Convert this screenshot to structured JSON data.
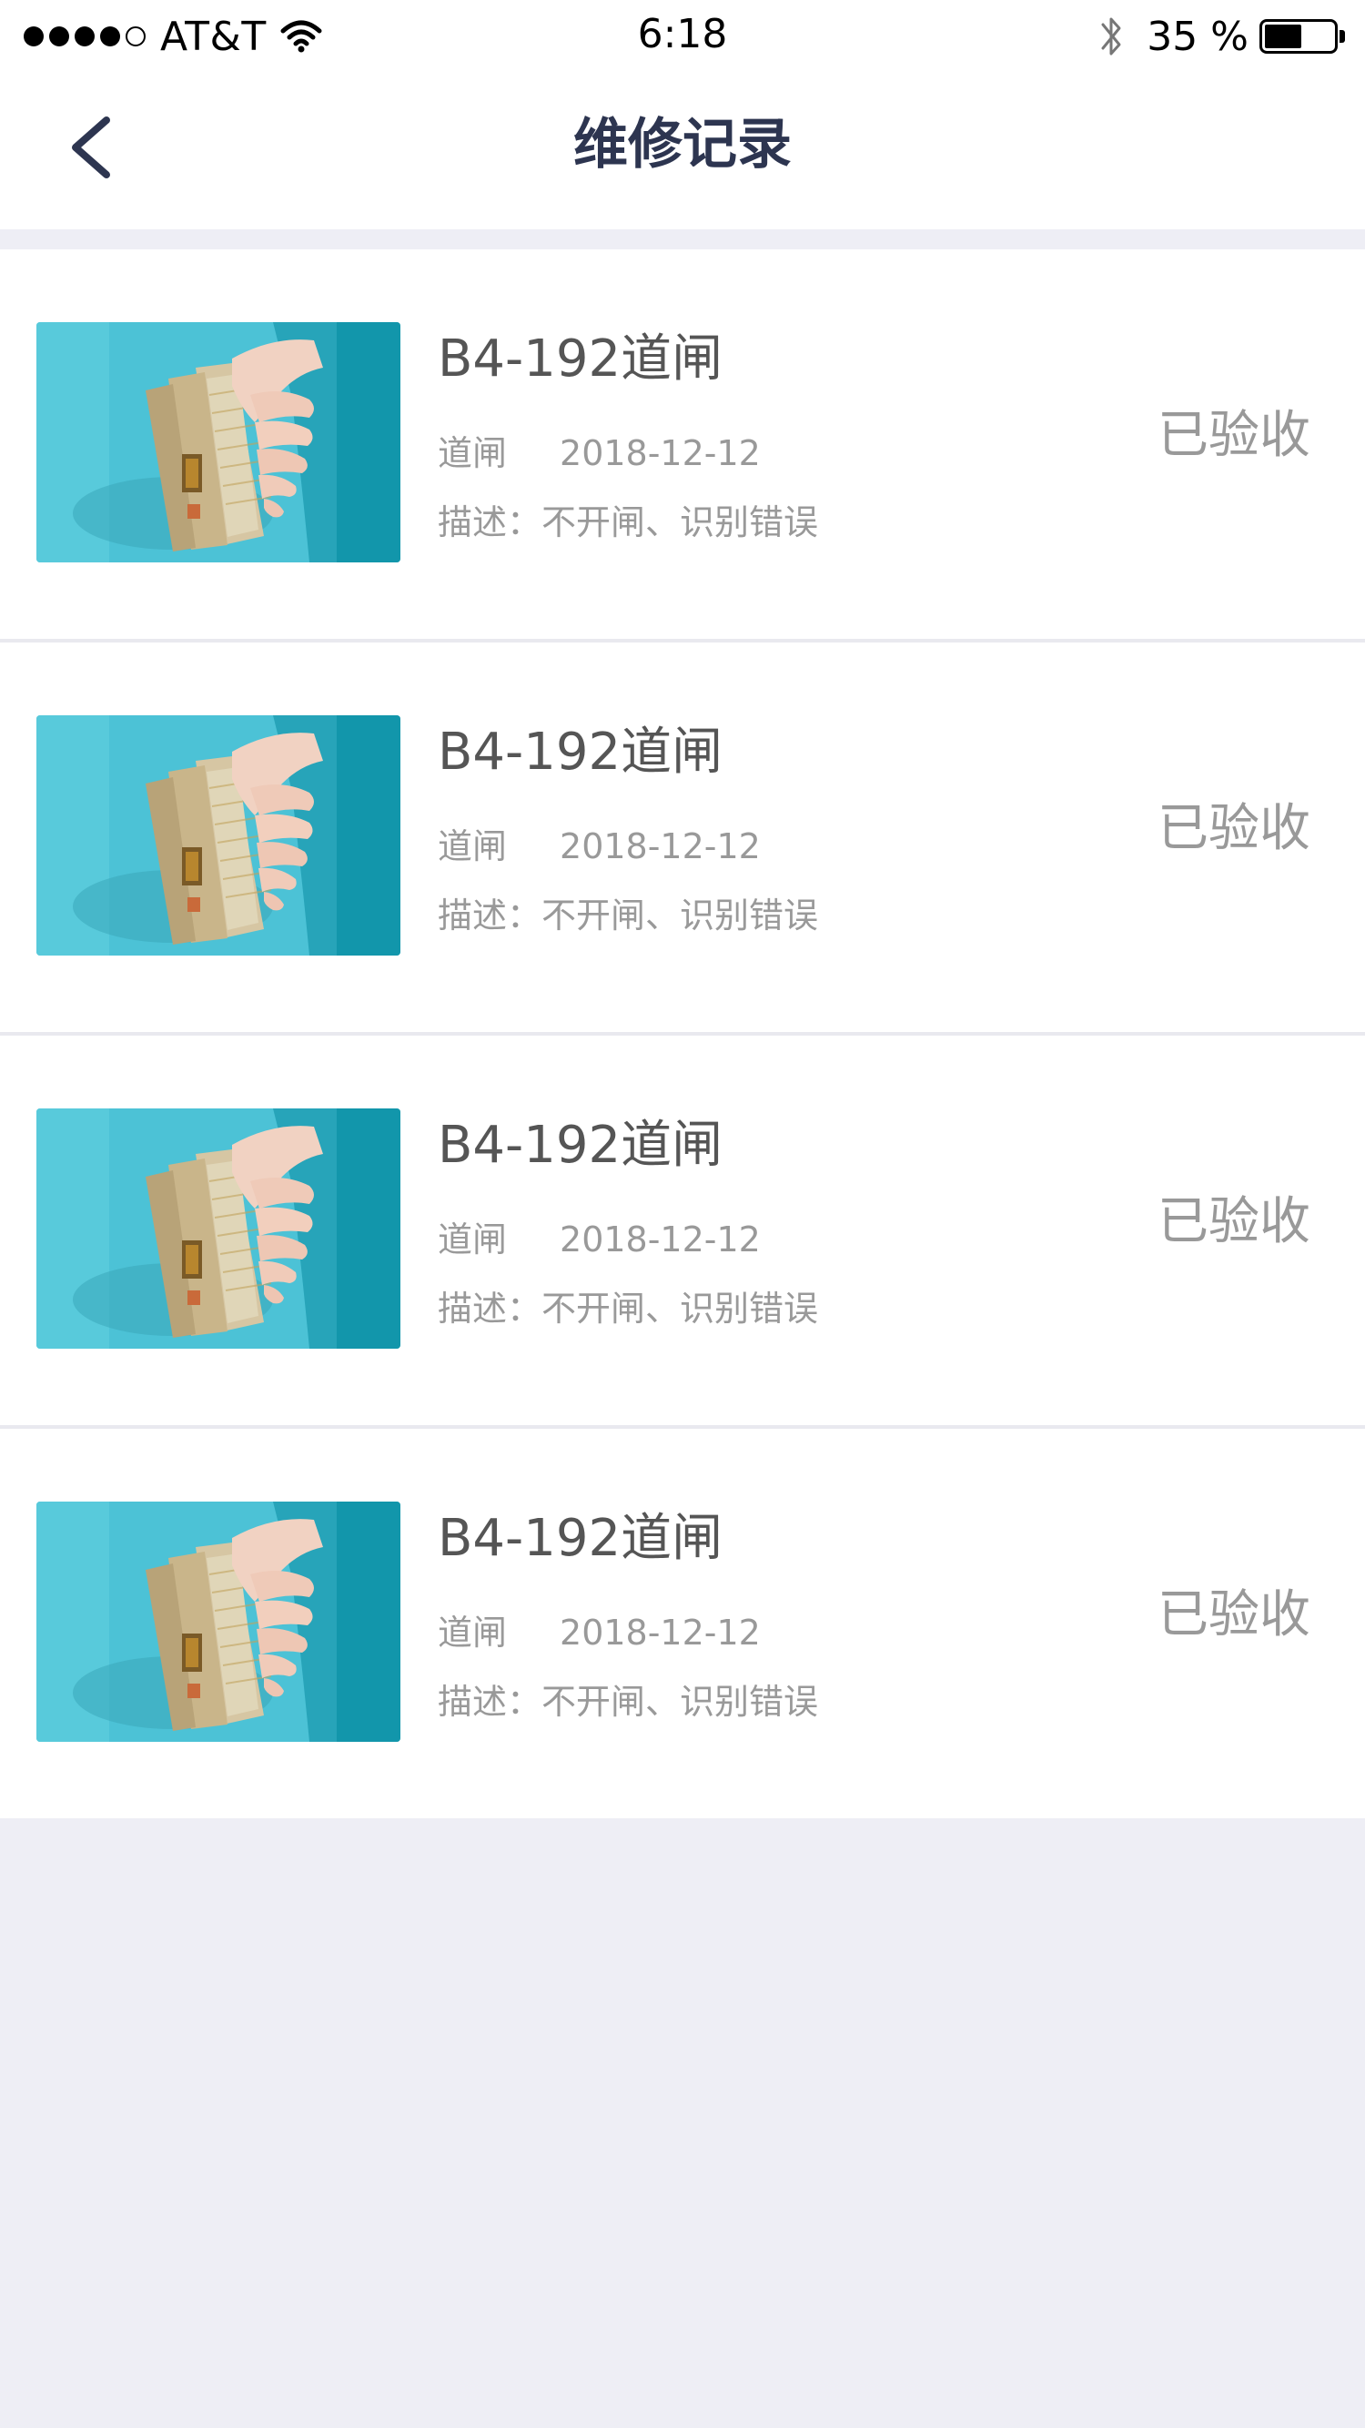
{
  "status_bar": {
    "carrier": "AT&T",
    "time": "6:18",
    "battery_text": "35 %",
    "signal_bars": 4,
    "signal_total": 5,
    "battery_level": 0.35
  },
  "nav": {
    "title": "维修记录",
    "back_icon": "chevron-left-icon"
  },
  "colors": {
    "title": "#2d3550",
    "page_background": "#eeeef5",
    "secondary_text": "#999999",
    "primary_text": "#555555"
  },
  "records": [
    {
      "title": "B4-192道闸",
      "type": "道闸",
      "date": "2018-12-12",
      "description": "描述：不开闸、识别错误",
      "status": "已验收"
    },
    {
      "title": "B4-192道闸",
      "type": "道闸",
      "date": "2018-12-12",
      "description": "描述：不开闸、识别错误",
      "status": "已验收"
    },
    {
      "title": "B4-192道闸",
      "type": "道闸",
      "date": "2018-12-12",
      "description": "描述：不开闸、识别错误",
      "status": "已验收"
    },
    {
      "title": "B4-192道闸",
      "type": "道闸",
      "date": "2018-12-12",
      "description": "描述：不开闸、识别错误",
      "status": "已验收"
    }
  ]
}
